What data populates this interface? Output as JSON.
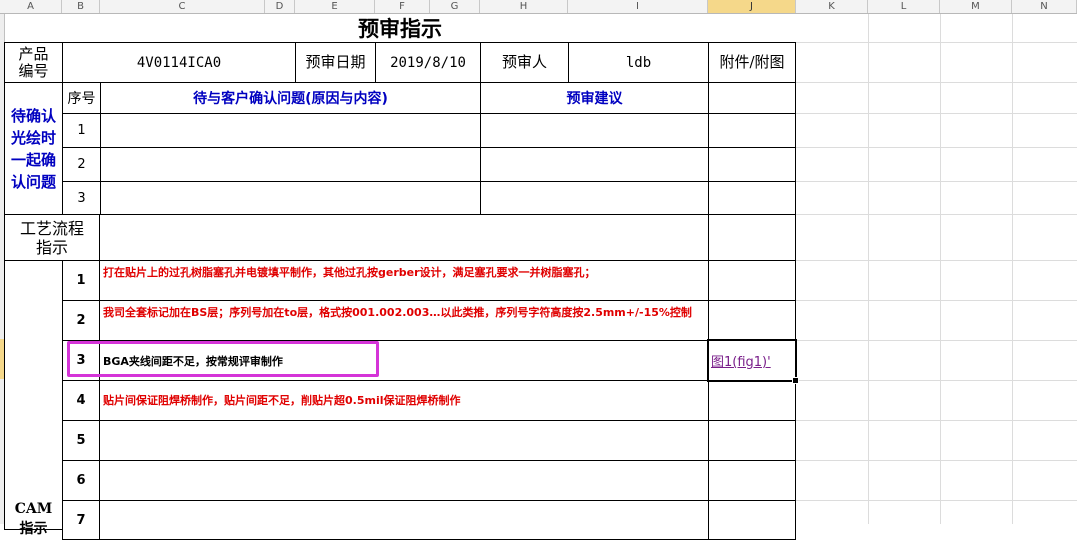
{
  "columns": [
    "A",
    "B",
    "C",
    "D",
    "E",
    "F",
    "G",
    "H",
    "I",
    "J",
    "K",
    "L",
    "M",
    "N"
  ],
  "active_column": "J",
  "colors": {
    "red_text": "#e00000",
    "blue_text": "#0000c0",
    "link": "#7a1f8a",
    "annotation": "#d534d8"
  },
  "sheet": {
    "title": "预审指示",
    "header": {
      "product_label": "产品\n编号",
      "product_value": "4V0114ICA0",
      "date_label": "预审日期",
      "date_value": "2019/8/10",
      "reviewer_label": "预审人",
      "reviewer_value": "ldb",
      "attach_label": "附件/附图"
    },
    "confirm": {
      "side_label": "待确认\n光绘时\n一起确\n认问题",
      "seq_header": "序号",
      "issue_header": "待与客户确认问题(原因与内容)",
      "suggest_header": "预审建议",
      "rows": [
        "1",
        "2",
        "3"
      ]
    },
    "process": {
      "label": "工艺流程\n指示"
    },
    "cam": {
      "side_label": "CAM\n指示",
      "rows": [
        {
          "no": "1",
          "text": "打在贴片上的过孔树脂塞孔并电镀填平制作，其他过孔按gerber设计，满足塞孔要求一并树脂塞孔；",
          "color": "red",
          "attach": ""
        },
        {
          "no": "2",
          "text": "我司全套标记加在BS层；序列号加在to层，格式按001.002.003…以此类推，序列号字符高度按2.5mm+/-15%控制",
          "color": "red",
          "attach": ""
        },
        {
          "no": "3",
          "text": "BGA夹线间距不足，按常规评审制作",
          "color": "black",
          "attach": "图1(fig1)'"
        },
        {
          "no": "4",
          "text": "贴片间保证阻焊桥制作，贴片间距不足，削贴片超0.5mil保证阻焊桥制作",
          "color": "red",
          "attach": ""
        },
        {
          "no": "5",
          "text": "",
          "color": "red",
          "attach": ""
        },
        {
          "no": "6",
          "text": "",
          "color": "red",
          "attach": ""
        },
        {
          "no": "7",
          "text": "",
          "color": "red",
          "attach": ""
        }
      ]
    }
  }
}
